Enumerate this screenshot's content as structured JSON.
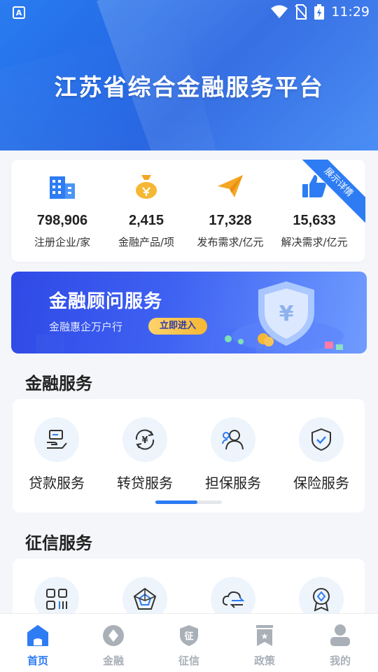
{
  "status": {
    "time": "11:29",
    "app_icon_letter": "A"
  },
  "header": {
    "title": "江苏省综合金融服务平台"
  },
  "stats": {
    "ribbon": "展示详情",
    "items": [
      {
        "icon": "building-icon",
        "value": "798,906",
        "label": "注册企业/家"
      },
      {
        "icon": "money-bag-icon",
        "value": "2,415",
        "label": "金融产品/项"
      },
      {
        "icon": "paper-plane-icon",
        "value": "17,328",
        "label": "发布需求/亿元"
      },
      {
        "icon": "thumbs-up-icon",
        "value": "15,633",
        "label": "解决需求/亿元"
      }
    ]
  },
  "banner": {
    "title": "金融顾问服务",
    "subtitle": "金融惠企万户行",
    "button": "立即进入",
    "shield_symbol": "¥"
  },
  "financial_services": {
    "title": "金融服务",
    "items": [
      {
        "icon": "loan-icon",
        "label": "贷款服务"
      },
      {
        "icon": "refinance-icon",
        "label": "转贷服务"
      },
      {
        "icon": "guarantee-icon",
        "label": "担保服务"
      },
      {
        "icon": "insurance-icon",
        "label": "保险服务"
      }
    ],
    "pager": {
      "pages": 2,
      "current": 1
    }
  },
  "credit_services": {
    "title": "征信服务",
    "items": [
      {
        "icon": "qr-grid-icon"
      },
      {
        "icon": "radar-chart-icon"
      },
      {
        "icon": "cloud-sync-icon"
      },
      {
        "icon": "medal-icon"
      }
    ]
  },
  "bottom_nav": {
    "items": [
      {
        "icon": "home-icon",
        "label": "首页",
        "active": true
      },
      {
        "icon": "finance-diamond-icon",
        "label": "金融",
        "glyph": "",
        "active": false
      },
      {
        "icon": "credit-shield-icon",
        "label": "征信",
        "glyph": "征",
        "active": false
      },
      {
        "icon": "policy-bookmark-icon",
        "label": "政策",
        "glyph": "★",
        "active": false
      },
      {
        "icon": "profile-icon",
        "label": "我的",
        "active": false
      }
    ]
  },
  "colors": {
    "primary": "#2d7cf3",
    "accent_gold": "#f5b734",
    "nav_inactive": "#aab0b8"
  }
}
